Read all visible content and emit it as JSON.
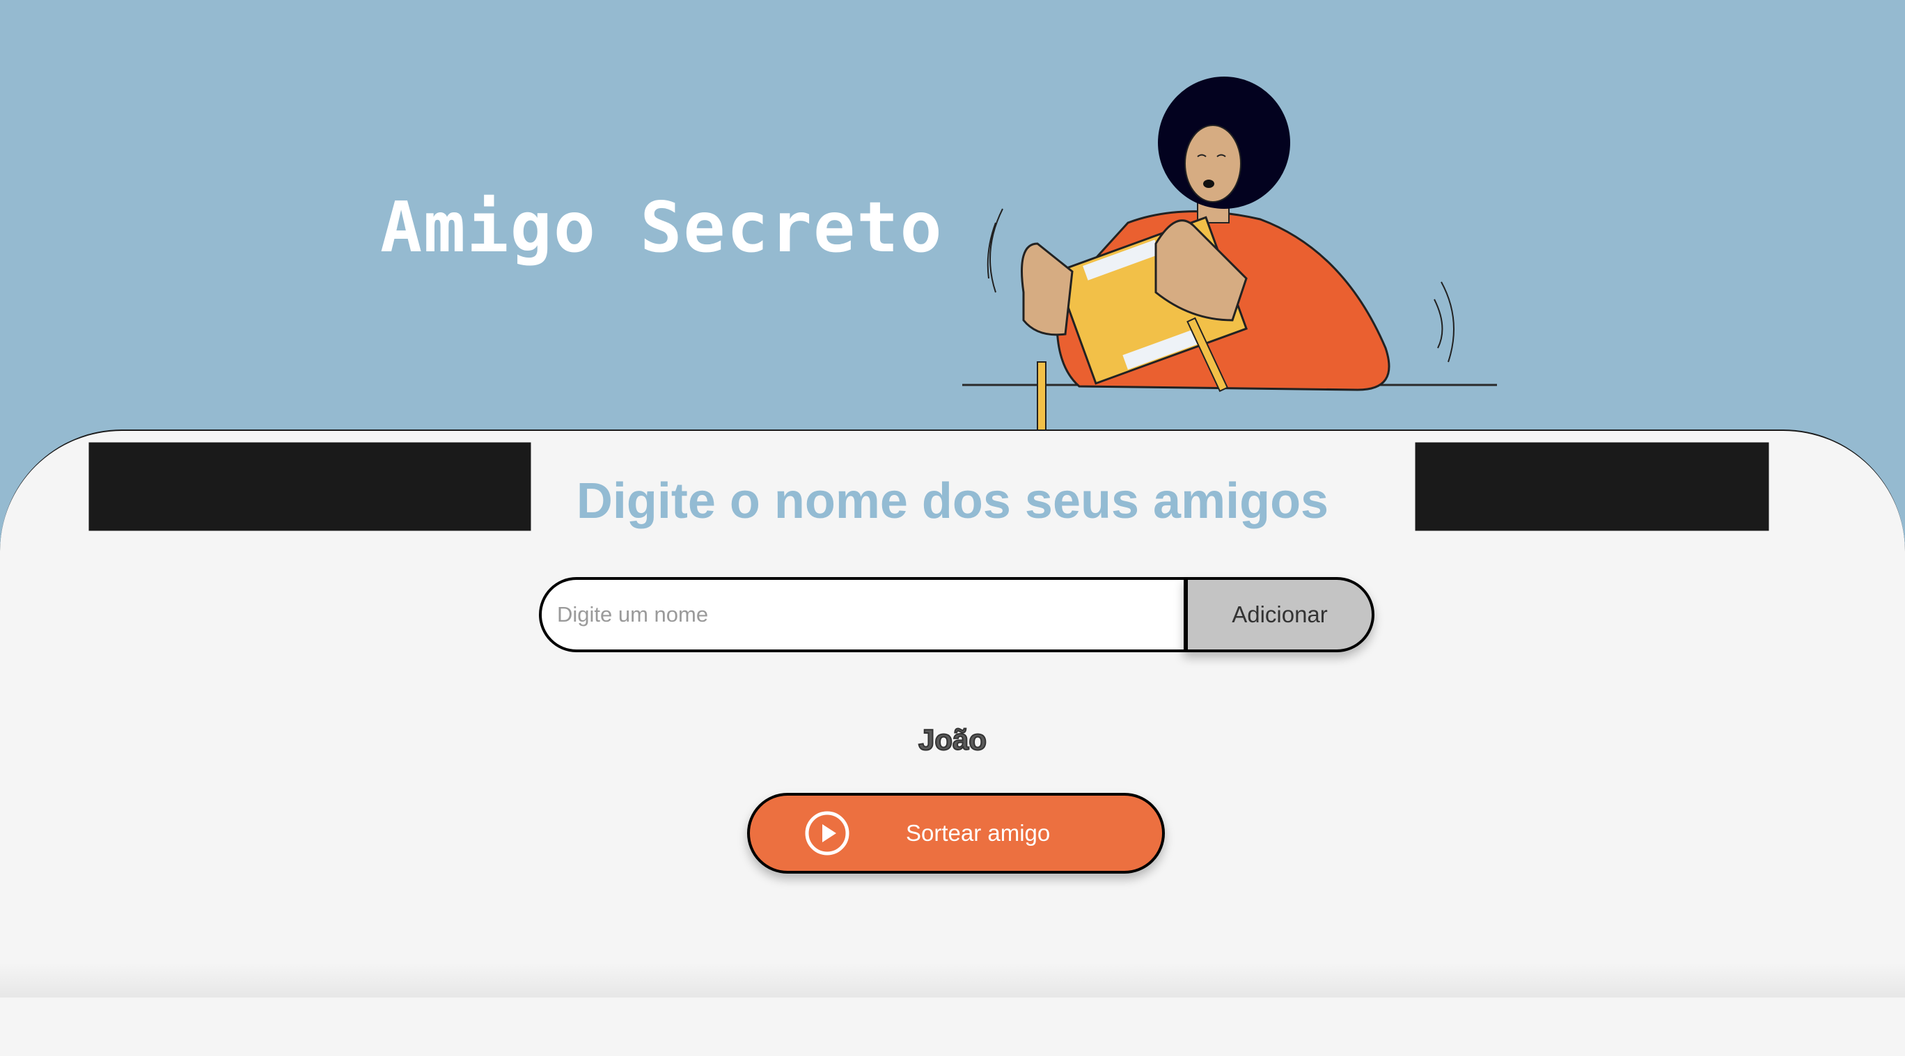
{
  "header": {
    "title": "Amigo Secreto",
    "illustration": "person-shaking-gift-box"
  },
  "main": {
    "heading": "Digite o nome dos seus amigos",
    "input": {
      "placeholder": "Digite um nome",
      "value": ""
    },
    "add_button_label": "Adicionar",
    "friends": [
      "João"
    ],
    "draw_button": {
      "label": "Sortear amigo",
      "icon": "play-circle-icon"
    }
  },
  "colors": {
    "header_bg": "#95bad0",
    "accent_heading": "#93bbd3",
    "draw_button": "#ec7040",
    "add_button": "#c4c4c4",
    "main_bg": "#f5f5f5"
  }
}
